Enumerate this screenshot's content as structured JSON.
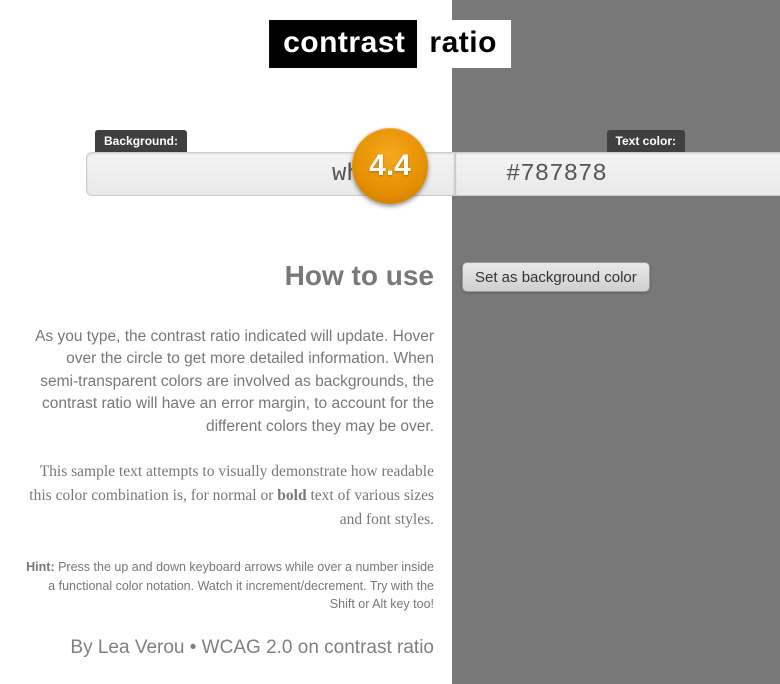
{
  "title": {
    "left": "contrast",
    "right": "ratio"
  },
  "labels": {
    "background": "Background:",
    "textcolor": "Text color:"
  },
  "inputs": {
    "background": "white",
    "foreground": "#787878"
  },
  "ratio": "4.4",
  "setButton": "Set as background color",
  "howto": {
    "heading": "How to use",
    "desc": "As you type, the contrast ratio indicated will update. Hover over the circle to get more detailed information. When semi-transparent colors are involved as backgrounds, the contrast ratio will have an error margin, to account for the different colors they may be over.",
    "sample_pre": "This sample text attempts to visually demonstrate how readable this color combination is, for normal or ",
    "sample_bold": "bold",
    "sample_post": " text of various sizes and font styles.",
    "hint_label": "Hint:",
    "hint_text": " Press the up and down keyboard arrows while over a number inside a functional color notation. Watch it increment/decrement. Try with the Shift or Alt key too!",
    "credits": "By Lea Verou • WCAG 2.0 on contrast ratio"
  },
  "colors": {
    "left_bg": "#ffffff",
    "right_bg": "#787878",
    "accent": "#e48f00"
  }
}
